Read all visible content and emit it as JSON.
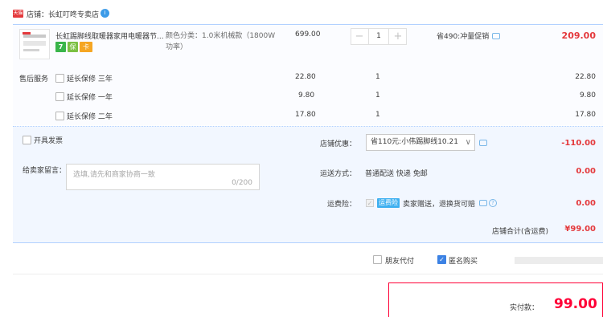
{
  "shop": {
    "logo_text": "天猫",
    "label": "店铺：长虹叮咚专卖店",
    "badge": "i"
  },
  "product": {
    "title": "长虹踢脚线取暖器家用电暖器节...",
    "icons": [
      "7",
      "保",
      "卡"
    ],
    "spec": "颜色分类：1.0米机械款（1800W功率）",
    "price": "699.00",
    "qty": "1",
    "qty_minus": "−",
    "qty_plus": "+",
    "promo": "省490:冲量促销",
    "subtotal": "209.00"
  },
  "service": {
    "label": "售后服务",
    "rows": [
      {
        "name": "延长保修 三年",
        "price": "22.80",
        "qty": "1",
        "total": "22.80"
      },
      {
        "name": "延长保修 一年",
        "price": "9.80",
        "qty": "1",
        "total": "9.80"
      },
      {
        "name": "延长保修 二年",
        "price": "17.80",
        "qty": "1",
        "total": "17.80"
      }
    ]
  },
  "invoice": {
    "label": "开具发票"
  },
  "message": {
    "label": "给卖家留言：",
    "placeholder": "选填,请先和商家协商一致",
    "counter": "0/200"
  },
  "shop_discount": {
    "label": "店铺优惠：",
    "selected": "省110元:小伟踢脚线10.21",
    "value": "-110.00"
  },
  "shipping": {
    "label": "运送方式：",
    "text": "普通配送 快递 免邮",
    "value": "0.00"
  },
  "insurance": {
    "label": "运费险：",
    "chip": "运费险",
    "text": "卖家赠送，退换货可赔",
    "value": "0.00"
  },
  "shop_total": {
    "label": "店铺合计(含运费)",
    "value": "¥99.00"
  },
  "options": {
    "friend_pay": "朋友代付",
    "anonymous": "匿名购买"
  },
  "submit": {
    "label": "实付款：",
    "amount": "99.00"
  },
  "colors": {
    "accent_red": "#e4393c",
    "border_blue": "#b2d1ff",
    "panel_bg": "#f2f7ff",
    "checkbox_blue": "#3c82e4"
  }
}
